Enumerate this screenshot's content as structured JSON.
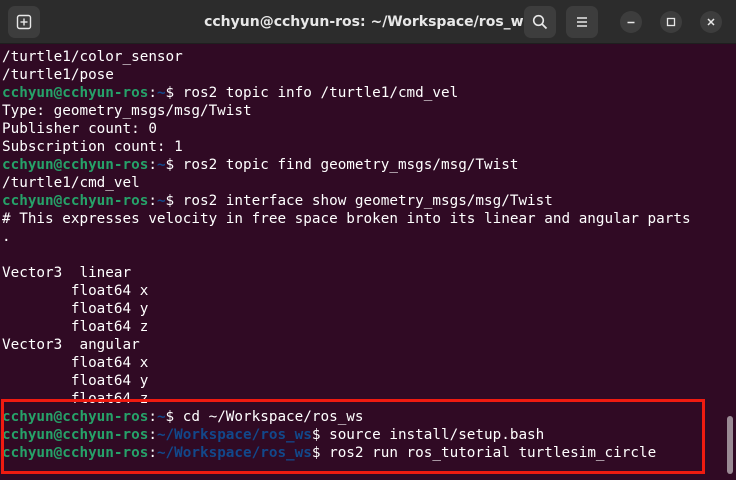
{
  "window": {
    "title": "cchyun@cchyun-ros: ~/Workspace/ros_ws",
    "buttons": {
      "new_tab_icon": "new-tab-icon",
      "search_icon": "search-icon",
      "menu_icon": "hamburger-menu-icon",
      "minimize_icon": "minimize-icon",
      "maximize_icon": "maximize-icon",
      "close_icon": "close-icon"
    }
  },
  "terminal": {
    "lines": [
      {
        "text": "/turtle1/color_sensor"
      },
      {
        "text": "/turtle1/pose"
      },
      {
        "user": "cchyun@cchyun-ros",
        "sep": ":",
        "path": "~",
        "cmd": "$ ros2 topic info /turtle1/cmd_vel"
      },
      {
        "text": "Type: geometry_msgs/msg/Twist"
      },
      {
        "text": "Publisher count: 0"
      },
      {
        "text": "Subscription count: 1"
      },
      {
        "user": "cchyun@cchyun-ros",
        "sep": ":",
        "path": "~",
        "cmd": "$ ros2 topic find geometry_msgs/msg/Twist"
      },
      {
        "text": "/turtle1/cmd_vel"
      },
      {
        "user": "cchyun@cchyun-ros",
        "sep": ":",
        "path": "~",
        "cmd": "$ ros2 interface show geometry_msgs/msg/Twist"
      },
      {
        "text": "# This expresses velocity in free space broken into its linear and angular parts"
      },
      {
        "text": "."
      },
      {
        "text": ""
      },
      {
        "text": "Vector3  linear"
      },
      {
        "text": "        float64 x"
      },
      {
        "text": "        float64 y"
      },
      {
        "text": "        float64 z"
      },
      {
        "text": "Vector3  angular"
      },
      {
        "text": "        float64 x"
      },
      {
        "text": "        float64 y"
      },
      {
        "text": "        float64 z"
      },
      {
        "user": "cchyun@cchyun-ros",
        "sep": ":",
        "path": "~",
        "cmd": "$ cd ~/Workspace/ros_ws"
      },
      {
        "user": "cchyun@cchyun-ros",
        "sep": ":",
        "path": "~/Workspace/ros_ws",
        "cmd": "$ source install/setup.bash"
      },
      {
        "user": "cchyun@cchyun-ros",
        "sep": ":",
        "path": "~/Workspace/ros_ws",
        "cmd": "$ ros2 run ros_tutorial turtlesim_circle"
      }
    ]
  },
  "colors": {
    "background": "#300a24",
    "prompt_user": "#26a269",
    "prompt_path": "#12488b",
    "highlight": "#f01b10"
  }
}
